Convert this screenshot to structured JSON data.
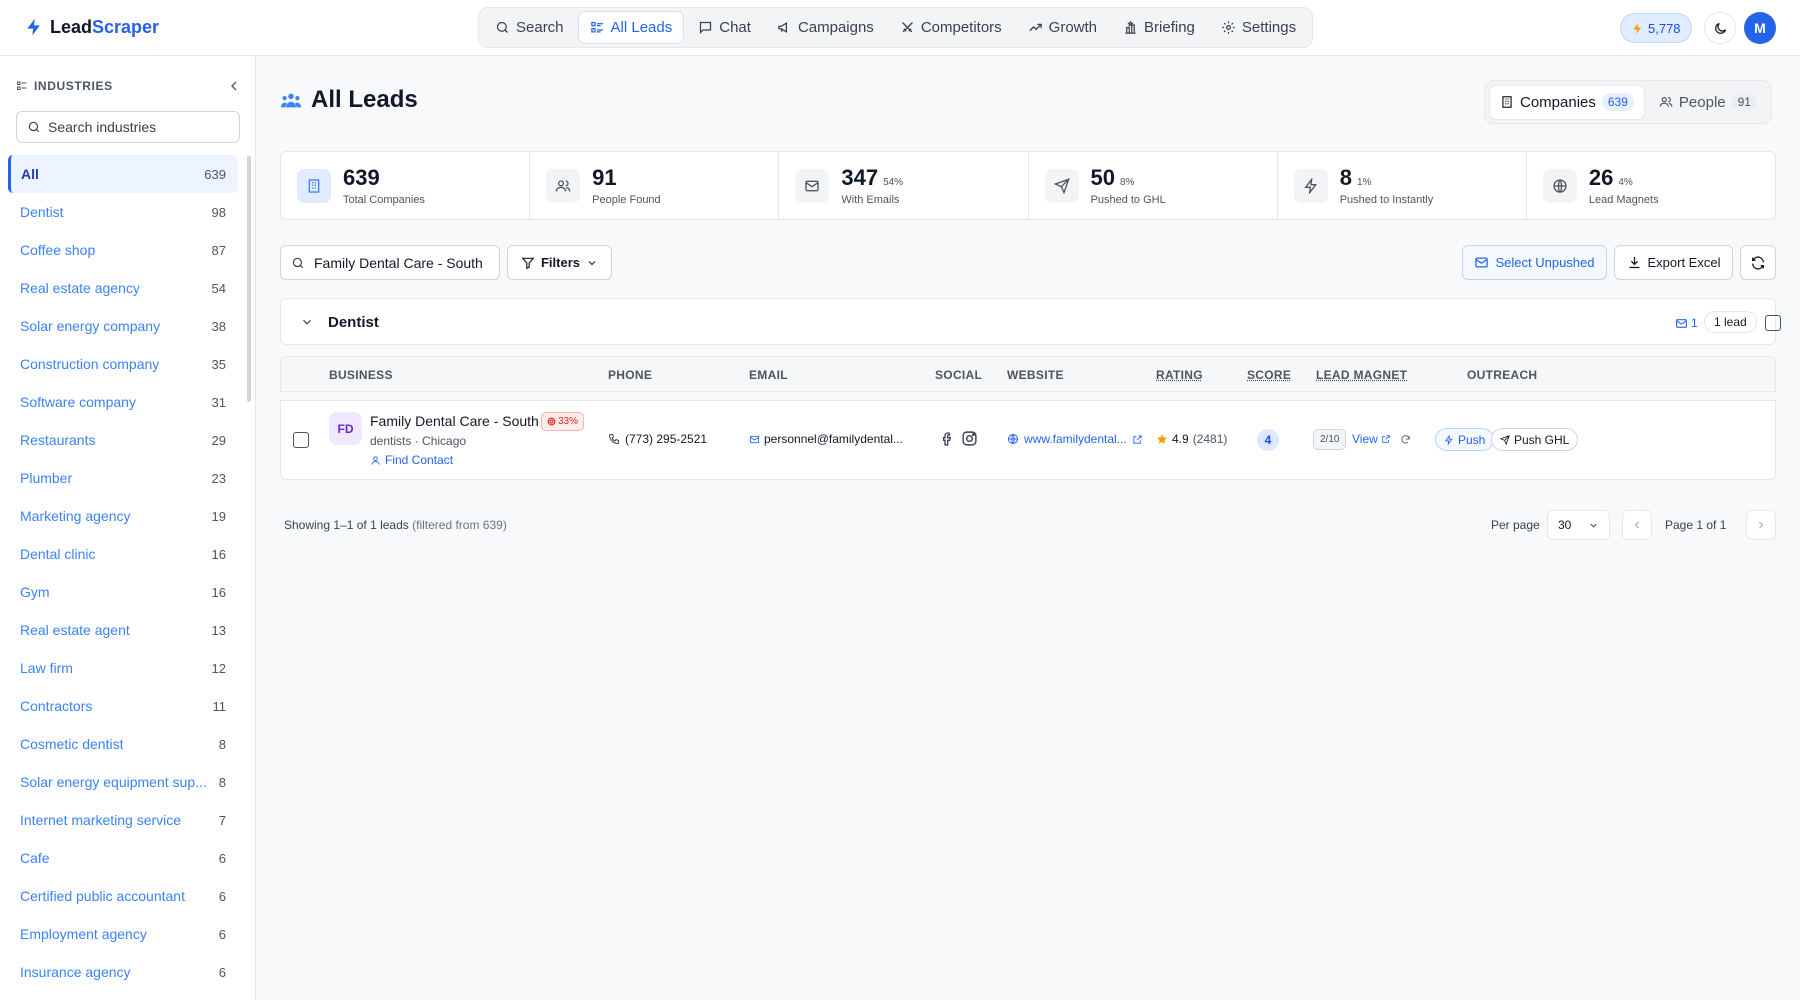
{
  "app": {
    "name_part1": "Lead",
    "name_part2": "Scraper"
  },
  "nav": [
    {
      "label": "Search",
      "icon": "search-icon",
      "active": false
    },
    {
      "label": "All Leads",
      "icon": "list-icon",
      "active": true
    },
    {
      "label": "Chat",
      "icon": "chat-icon",
      "active": false
    },
    {
      "label": "Campaigns",
      "icon": "megaphone-icon",
      "active": false
    },
    {
      "label": "Competitors",
      "icon": "swords-icon",
      "active": false
    },
    {
      "label": "Growth",
      "icon": "trending-up-icon",
      "active": false
    },
    {
      "label": "Briefing",
      "icon": "podium-icon",
      "active": false
    },
    {
      "label": "Settings",
      "icon": "gear-icon",
      "active": false
    }
  ],
  "header": {
    "credits": "5,778",
    "avatar_initial": "M"
  },
  "sidebar": {
    "title": "INDUSTRIES",
    "search_placeholder": "Search industries",
    "items": [
      {
        "label": "All",
        "count": "639",
        "active": true
      },
      {
        "label": "Dentist",
        "count": "98"
      },
      {
        "label": "Coffee shop",
        "count": "87"
      },
      {
        "label": "Real estate agency",
        "count": "54"
      },
      {
        "label": "Solar energy company",
        "count": "38"
      },
      {
        "label": "Construction company",
        "count": "35"
      },
      {
        "label": "Software company",
        "count": "31"
      },
      {
        "label": "Restaurants",
        "count": "29"
      },
      {
        "label": "Plumber",
        "count": "23"
      },
      {
        "label": "Marketing agency",
        "count": "19"
      },
      {
        "label": "Dental clinic",
        "count": "16"
      },
      {
        "label": "Gym",
        "count": "16"
      },
      {
        "label": "Real estate agent",
        "count": "13"
      },
      {
        "label": "Law firm",
        "count": "12"
      },
      {
        "label": "Contractors",
        "count": "11"
      },
      {
        "label": "Cosmetic dentist",
        "count": "8"
      },
      {
        "label": "Solar energy equipment sup...",
        "count": "8"
      },
      {
        "label": "Internet marketing service",
        "count": "7"
      },
      {
        "label": "Cafe",
        "count": "6"
      },
      {
        "label": "Certified public accountant",
        "count": "6"
      },
      {
        "label": "Employment agency",
        "count": "6"
      },
      {
        "label": "Insurance agency",
        "count": "6"
      }
    ]
  },
  "page": {
    "title": "All Leads"
  },
  "view_toggle": {
    "companies_label": "Companies",
    "companies_count": "639",
    "people_label": "People",
    "people_count": "91"
  },
  "stats": [
    {
      "value": "639",
      "pct": "",
      "label": "Total Companies",
      "icon": "building-icon"
    },
    {
      "value": "91",
      "pct": "",
      "label": "People Found",
      "icon": "users-icon"
    },
    {
      "value": "347",
      "pct": "54%",
      "label": "With Emails",
      "icon": "mail-icon"
    },
    {
      "value": "50",
      "pct": "8%",
      "label": "Pushed to GHL",
      "icon": "send-icon"
    },
    {
      "value": "8",
      "pct": "1%",
      "label": "Pushed to Instantly",
      "icon": "bolt-icon"
    },
    {
      "value": "26",
      "pct": "4%",
      "label": "Lead Magnets",
      "icon": "globe-icon"
    }
  ],
  "toolbar": {
    "search_value": "Family Dental Care - South",
    "filters_label": "Filters",
    "select_unpushed_label": "Select Unpushed",
    "export_label": "Export Excel"
  },
  "group": {
    "title": "Dentist",
    "email_count": "1",
    "lead_count": "1 lead"
  },
  "table": {
    "headers": {
      "business": "BUSINESS",
      "phone": "PHONE",
      "email": "EMAIL",
      "social": "SOCIAL",
      "website": "WEBSITE",
      "rating": "RATING",
      "score": "SCORE",
      "lead_magnet": "LEAD MAGNET",
      "outreach": "OUTREACH"
    },
    "rows": [
      {
        "initials": "FD",
        "name": "Family Dental Care - South ...",
        "match_pct": "33%",
        "category": "dentists",
        "city": "Chicago",
        "find_contact": "Find Contact",
        "phone": "(773) 295-2521",
        "email": "personnel@familydental...",
        "website": "www.familydental...",
        "rating": "4.9",
        "rating_count": "(2481)",
        "score": "4",
        "lead_magnet": "2/10",
        "view_label": "View",
        "push_label": "Push",
        "push_ghl_label": "Push GHL"
      }
    ]
  },
  "footer": {
    "showing": "Showing 1–1 of 1 leads",
    "filtered": "(filtered from 639)",
    "per_page_label": "Per page",
    "per_page_value": "30",
    "page_label": "Page 1 of 1"
  },
  "colors": {
    "accent": "#2563eb",
    "danger": "#dc2626",
    "star": "#f59e0b"
  }
}
